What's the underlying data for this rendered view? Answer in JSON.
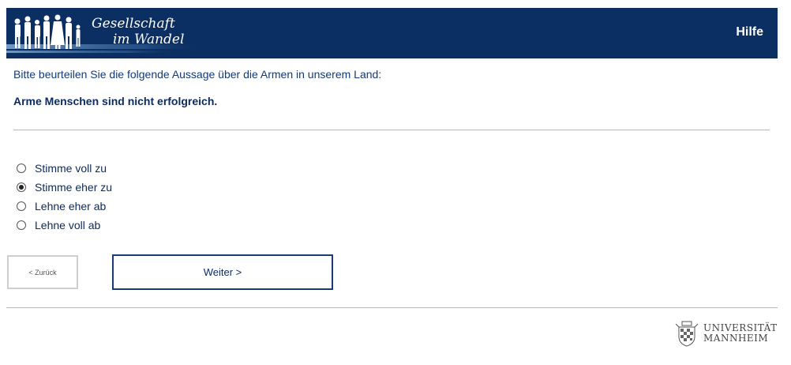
{
  "header": {
    "logo_line1": "Gesellschaft",
    "logo_line2": "im Wandel",
    "help_label": "Hilfe",
    "background_color": "#0b2f62"
  },
  "question": {
    "intro": "Bitte beurteilen Sie die folgende Aussage über die Armen in unserem Land:",
    "statement": "Arme Menschen sind nicht erfolgreich."
  },
  "options": [
    {
      "label": "Stimme voll zu",
      "selected": false
    },
    {
      "label": "Stimme eher zu",
      "selected": true
    },
    {
      "label": "Lehne eher ab",
      "selected": false
    },
    {
      "label": "Lehne voll ab",
      "selected": false
    }
  ],
  "navigation": {
    "back_label": "< Zurück",
    "next_label": "Weiter >"
  },
  "footer": {
    "logo_line1": "UNIVERSITÄT",
    "logo_line2": "MANNHEIM",
    "logo_icon": "university-crest-icon"
  }
}
